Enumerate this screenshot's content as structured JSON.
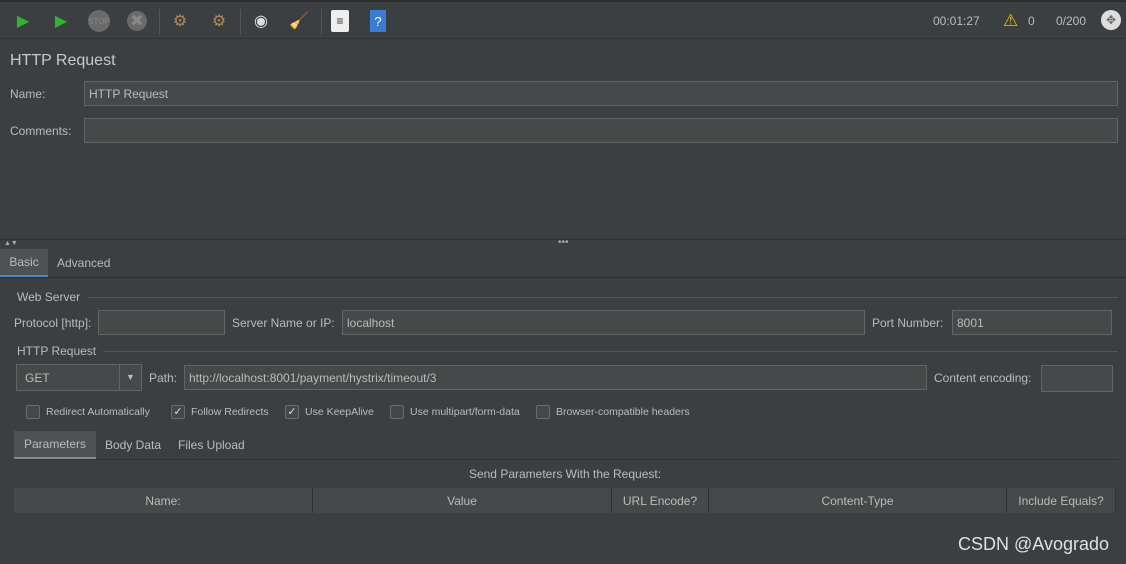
{
  "toolbar": {
    "icons": [
      "start-icon",
      "start-no-pause-icon",
      "stop-icon",
      "shutdown-icon",
      "clear-icon",
      "clear-all-icon",
      "search-icon",
      "reset-search-icon",
      "function-helper-icon",
      "help-icon"
    ],
    "timer": "00:01:27",
    "warnings": "0",
    "threads": "0/200"
  },
  "title": "HTTP Request",
  "name_label": "Name:",
  "name_value": "HTTP Request",
  "comments_label": "Comments:",
  "comments_value": "",
  "tabs": [
    "Basic",
    "Advanced"
  ],
  "web_server": {
    "legend": "Web Server",
    "protocol_label": "Protocol [http]:",
    "protocol_value": "",
    "server_label": "Server Name or IP:",
    "server_value": "localhost",
    "port_label": "Port Number:",
    "port_value": "8001"
  },
  "http_request": {
    "legend": "HTTP Request",
    "method": "GET",
    "path_label": "Path:",
    "path_value": "http://localhost:8001/payment/hystrix/timeout/3",
    "encoding_label": "Content encoding:",
    "encoding_value": ""
  },
  "checkboxes": [
    {
      "label": "Redirect Automatically",
      "checked": false
    },
    {
      "label": "Follow Redirects",
      "checked": true
    },
    {
      "label": "Use KeepAlive",
      "checked": true
    },
    {
      "label": "Use multipart/form-data",
      "checked": false
    },
    {
      "label": "Browser-compatible headers",
      "checked": false
    }
  ],
  "subtabs": [
    "Parameters",
    "Body Data",
    "Files Upload"
  ],
  "params_caption": "Send Parameters With the Request:",
  "columns": [
    "Name:",
    "Value",
    "URL Encode?",
    "Content-Type",
    "Include Equals?"
  ],
  "watermark": "CSDN @Avogrado"
}
